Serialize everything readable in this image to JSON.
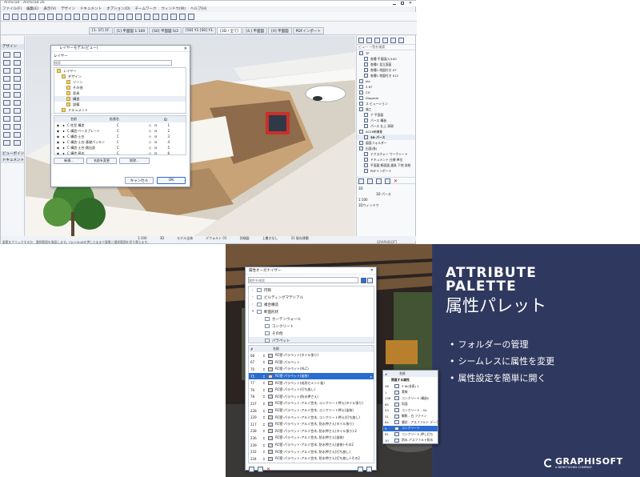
{
  "archicad": {
    "title_bar": "Archicad - Archicad 26",
    "menu": [
      "ファイル(F)",
      "編集(E)",
      "表示(V)",
      "デザイン",
      "ドキュメント",
      "オプション(O)",
      "チームワーク",
      "ウィンドウ(W)",
      "ヘルプ(H)"
    ],
    "tabs": [
      "[1. 1F] 1F",
      "[1] 平面図 1:100",
      "[S0] 平面図 S/2",
      "[S0] Y1 [S0] Y1",
      "[3D / 全て]",
      "[4.] 平面図",
      "[A] 平面図",
      "PDFインポート"
    ],
    "left_palette": [
      "デザイン",
      "ビューポイント",
      "ドキュメント"
    ],
    "layer_dialog": {
      "title": "レイヤーモデル(ビュー)",
      "search_label": "レイヤー",
      "search_placeholder": "検索",
      "tree": [
        "レイヤー",
        "デザイン",
        "ゾーン",
        "その他",
        "家具",
        "構造",
        "設備",
        "ドキュメント"
      ],
      "table_headers": [
        "名前",
        "拡張名",
        "ID"
      ],
      "table_rows": [
        {
          "name": "C 柱型 構造",
          "ext": "C",
          "id": "1"
        },
        {
          "name": "C 構造-ベースプレート",
          "ext": "C",
          "id": "2"
        },
        {
          "name": "C 構造-土台",
          "ext": "C",
          "id": "3"
        },
        {
          "name": "C 構造-土台-基礎パッキン",
          "ext": "C",
          "id": "4"
        },
        {
          "name": "C 構造-土台-跳出部",
          "ext": "C",
          "id": "5"
        },
        {
          "name": "C 構造-基本",
          "ext": "C",
          "id": "6"
        }
      ],
      "buttons": [
        "新規...",
        "名前を変更",
        "削除..."
      ],
      "cancel": "キャンセル",
      "ok": "OK"
    },
    "navigator": {
      "header": "ビュー 一覧を検索",
      "items": [
        "3F",
        "各種 平面図(1/100",
        "各種1 見立面図",
        "各種1 地図付き X7",
        "各種1 地図付き X12",
        "etc",
        "3 67",
        "CG",
        "Diagram",
        "ス ビューション",
        "施工",
        "ア 平面図",
        "パース 構造",
        "パース 仕上 表現",
        "AC26新機能",
        "3D パース",
        "図面フォルダー",
        "出面(各)",
        "テクスチャー ワークシート",
        "ドキュメント 仕様 単位",
        "平面図 断面図 建具 下地 詳細",
        "PDFインポート"
      ],
      "props": {
        "id": "3D",
        "name": "3D パース",
        "scale": "1:100",
        "view": "3Dウィンドウ"
      }
    },
    "statusbar": [
      "1:100",
      "3D",
      "モデル全体",
      "デフォルト 01",
      "詳細図",
      "上書きなし",
      "01 既存建築"
    ],
    "hint": "要素をクリックするか、選択範囲を描画します。Ctrl+Shiftを押したままで要素と選択範囲を切り替えます。",
    "brand": "GRAPHISOFT"
  },
  "attr": {
    "dialog_title": "属性オーガナイザー",
    "search_placeholder": "属性を検索",
    "tree": [
      {
        "label": "円筒",
        "depth": 0
      },
      {
        "label": "ビルディングマテリアル",
        "depth": 0
      },
      {
        "label": "複合構造",
        "depth": 0
      },
      {
        "label": "断面形状",
        "depth": 0
      },
      {
        "label": "カーテンウォール",
        "depth": 1
      },
      {
        "label": "コンクリート",
        "depth": 1
      },
      {
        "label": "その他",
        "depth": 1
      },
      {
        "label": "パラペット",
        "depth": 1
      }
    ],
    "list_header": [
      "#",
      "名前"
    ],
    "list": [
      {
        "id": "68",
        "name": "RC壁-パラペット(タイル張り)"
      },
      {
        "id": "67",
        "name": "RC壁-パラペット"
      },
      {
        "id": "70",
        "name": "RC壁-パラペット(ALC)"
      },
      {
        "id": "75",
        "name": "RC壁-パラペット(塗装)",
        "selected": true
      },
      {
        "id": "77",
        "name": "RC壁-パラペット(成形セメント板)"
      },
      {
        "id": "76",
        "name": "RC壁-パラペット(打ち放し)"
      },
      {
        "id": "78",
        "name": "RC壁-パラペット(防水押さえ)"
      },
      {
        "id": "237",
        "name": "RC壁-パラペット-アルミ笠木, コンクリート押え(タイル張り)"
      },
      {
        "id": "228",
        "name": "RC壁-パラペット-アルミ笠木, コンクリート押え(塗装)"
      },
      {
        "id": "229",
        "name": "RC壁-パラペット-アルミ笠木, コンクリート押え(打ち放し)"
      },
      {
        "id": "117",
        "name": "RC壁-パラペット-アルミ笠木, 防水押さえ(タイル張り)"
      },
      {
        "id": "238",
        "name": "RC壁-パラペット-アルミ笠木, 防水押さえ(タイル張り)-2"
      },
      {
        "id": "236",
        "name": "RC壁-パラペット-アルミ笠木, 防水押さえ(塗装)"
      },
      {
        "id": "239",
        "name": "RC壁-パラペット-アルミ笠木, 防水押さえ(塗装)-その2"
      },
      {
        "id": "232",
        "name": "RC壁-パラペット-アルミ笠木, 防水押さえ(打ち放し)"
      },
      {
        "id": "234",
        "name": "RC壁-パラペット-アルミ笠木, 防水押さえ(打ち放し)-その2"
      }
    ],
    "related": {
      "header_id": "#",
      "header_name": "名前",
      "section": "関連する属性",
      "rows": [
        {
          "id": "28",
          "name": "3 W(非表) 1"
        },
        {
          "id": "1",
          "name": "実線"
        },
        {
          "id": "136",
          "name": "コンクリート-構造2"
        },
        {
          "id": "65",
          "name": "両面"
        },
        {
          "id": "53",
          "name": "コンクリート - 04"
        },
        {
          "id": "31",
          "name": "御影 - 白 ファイン"
        },
        {
          "id": "84",
          "name": "膜状 - アスファルト データ"
        },
        {
          "id": "5",
          "name": "コンクリート",
          "selected": true
        },
        {
          "id": "81",
          "name": "コンクリート-押し打ち"
        },
        {
          "id": "10",
          "name": "防水-アスファルト防水"
        }
      ]
    },
    "headline_1": "ATTRIBUTE",
    "headline_2": "PALETTE",
    "headline_jp": "属性パレット",
    "bullets": [
      "フォルダーの管理",
      "シームレスに属性を変更",
      "属性設定を簡単に開く"
    ],
    "brand": "GRAPHISOFT",
    "brand_sub": "A NEMETSCHEK COMPANY"
  },
  "colors": {
    "accent": "#2a6ccf",
    "panel": "#2f3a63"
  }
}
